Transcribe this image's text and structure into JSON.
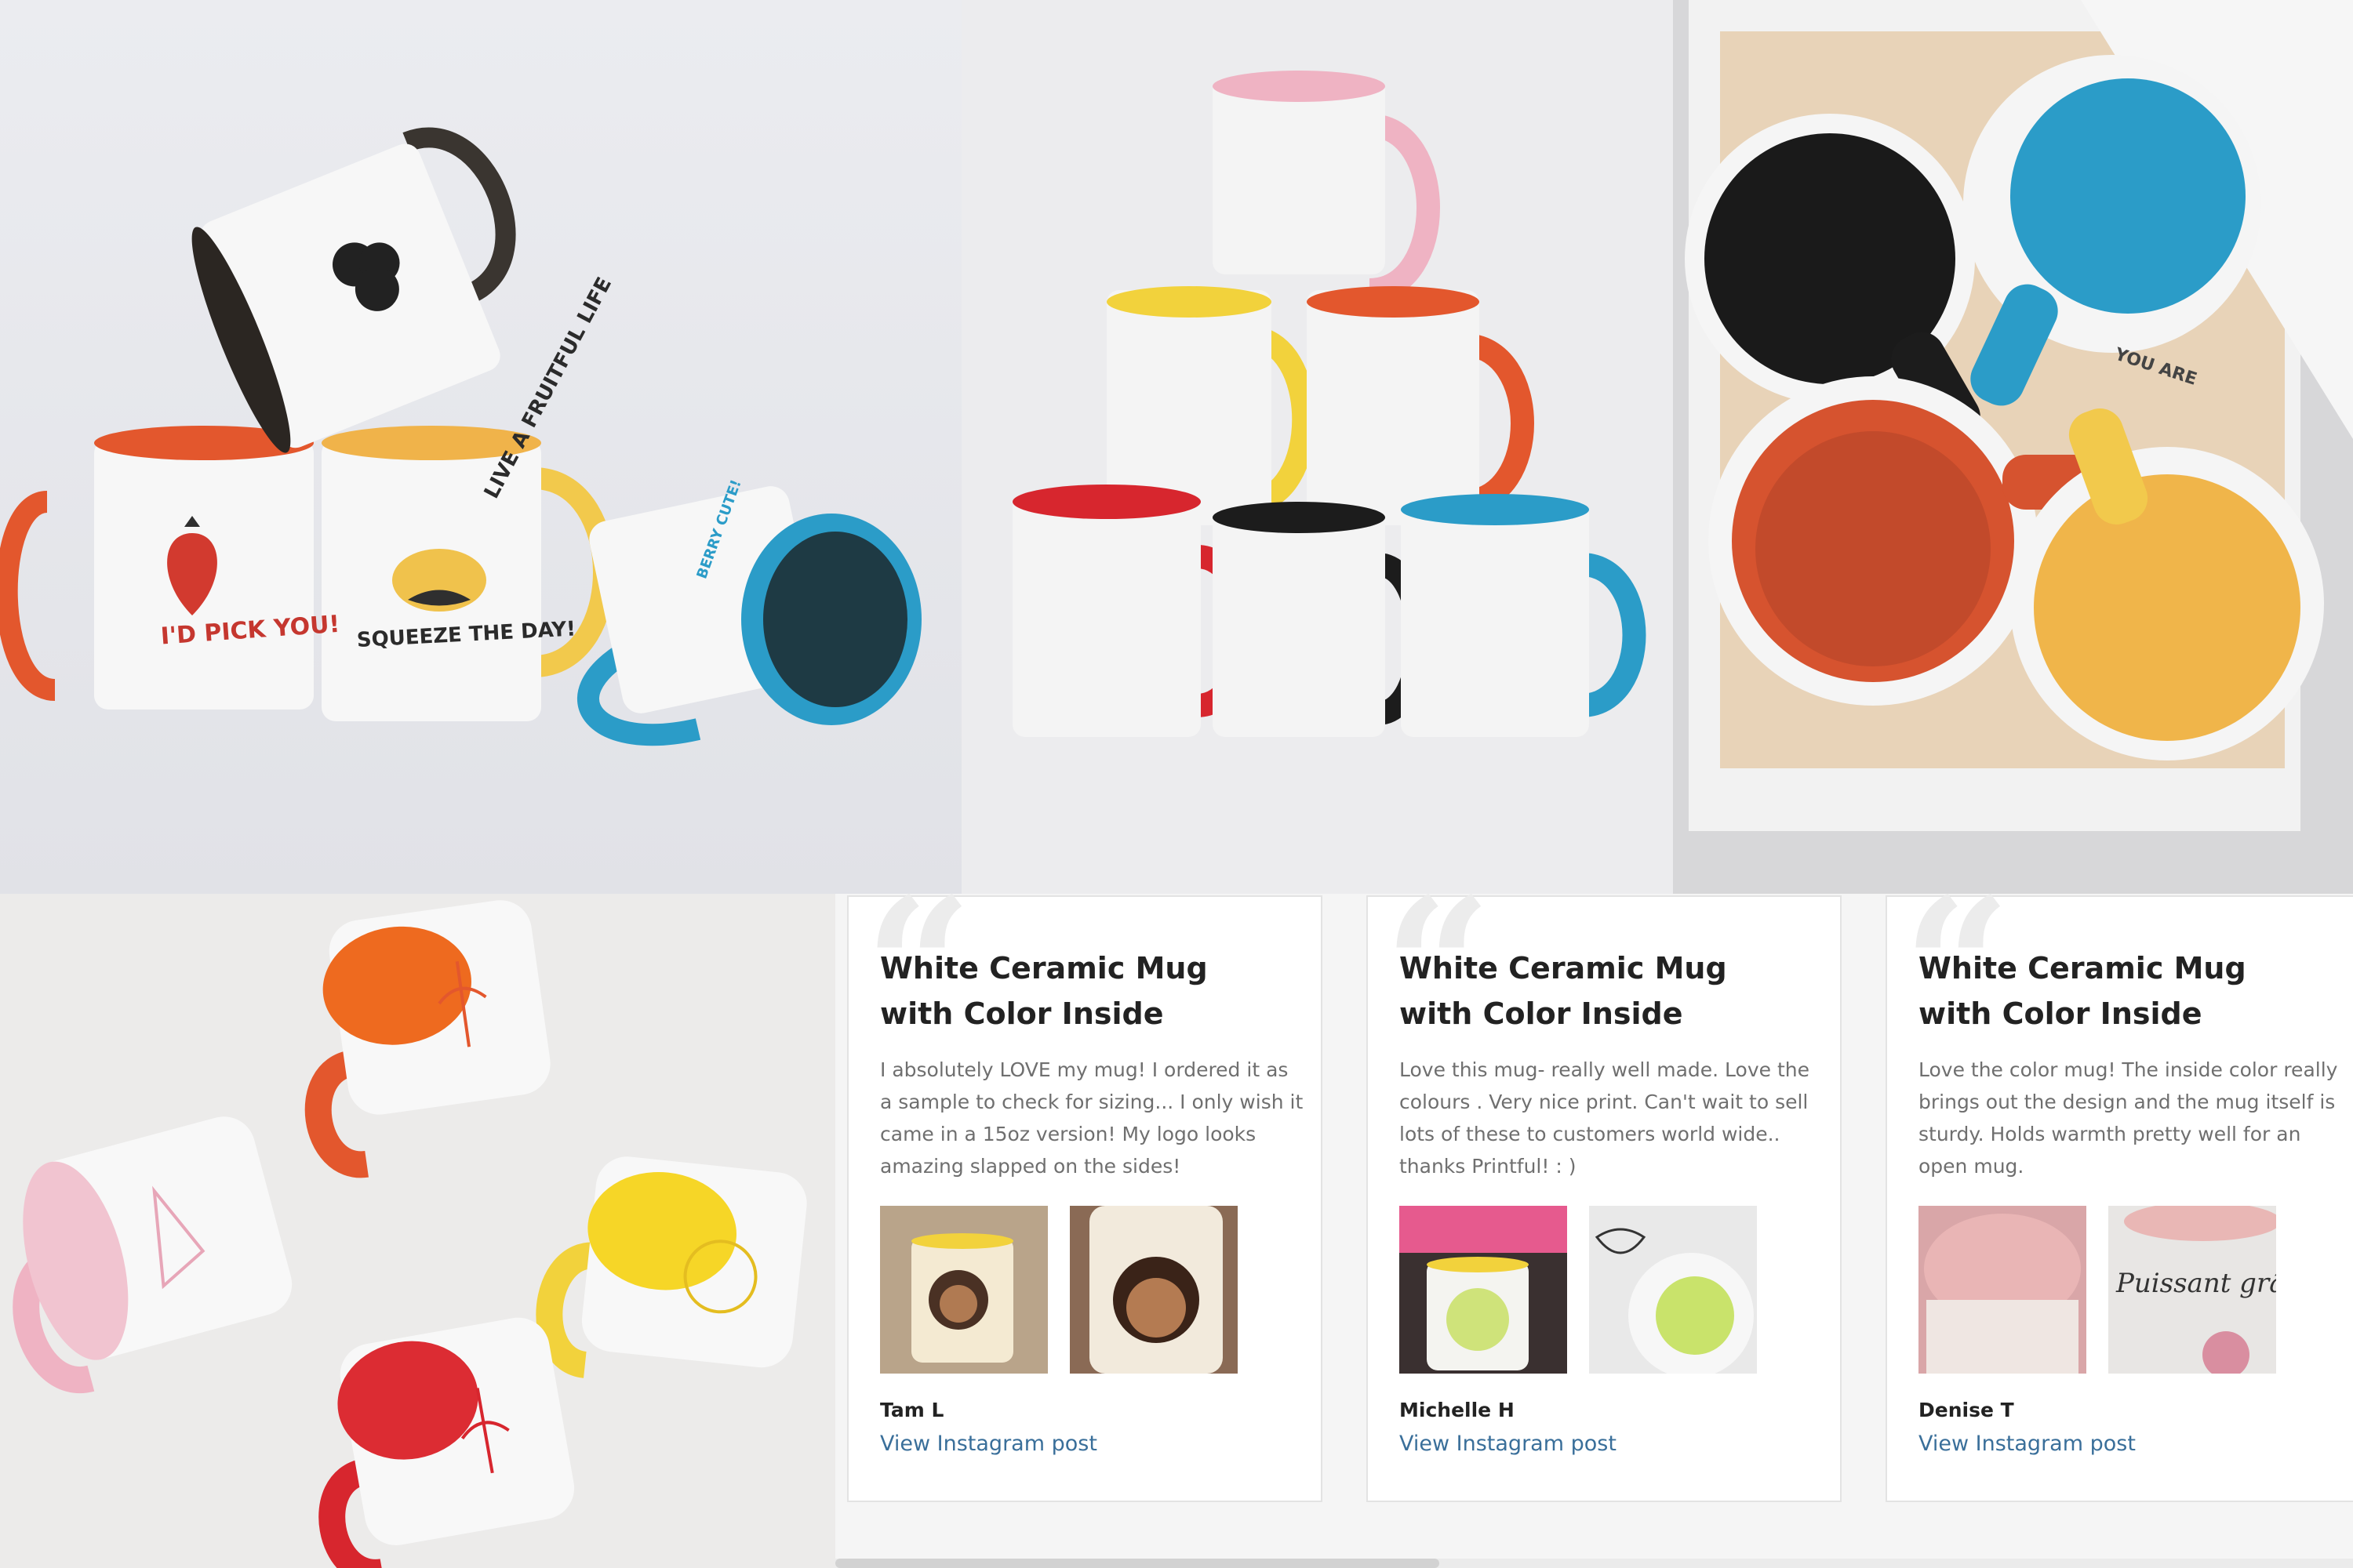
{
  "photos": [
    {
      "id": "photo-1",
      "mug_texts": [
        "LIVE A FRUITFUL LIFE",
        "I'D PICK YOU!",
        "SQUEEZE THE DAY!",
        "BERRY CUTE!"
      ]
    },
    {
      "id": "photo-2"
    },
    {
      "id": "photo-3",
      "mug_texts": [
        "YOU ARE"
      ]
    },
    {
      "id": "photo-4"
    }
  ],
  "reviews": [
    {
      "title": "White Ceramic Mug with Color Inside",
      "text": "I absolutely LOVE my mug! I ordered it as a sample to check for sizing... I only wish it came in a 15oz version! My logo looks amazing slapped on the sides!",
      "author": "Tam L",
      "link": "View Instagram post"
    },
    {
      "title": "White Ceramic Mug with Color Inside",
      "text": "Love this mug- really well made. Love the colours . Very nice print. Can't wait to sell lots of these to customers world wide.. thanks Printful! : )",
      "author": "Michelle H",
      "link": "View Instagram post"
    },
    {
      "title": "White Ceramic Mug with Color Inside",
      "text": "Love the color mug! The inside color really brings out the design and the mug itself is sturdy. Holds warmth pretty well for an open mug.",
      "author": "Denise T",
      "link": "View Instagram post",
      "thumb_text": "Puissant grâce à la foi"
    }
  ],
  "colors": {
    "orange": "#e3572d",
    "yellow": "#f2c94c",
    "blue": "#2b9cc8",
    "pink": "#efb3c3",
    "red": "#d7262e",
    "black": "#1c1c1c",
    "link": "#3a6f9a"
  }
}
